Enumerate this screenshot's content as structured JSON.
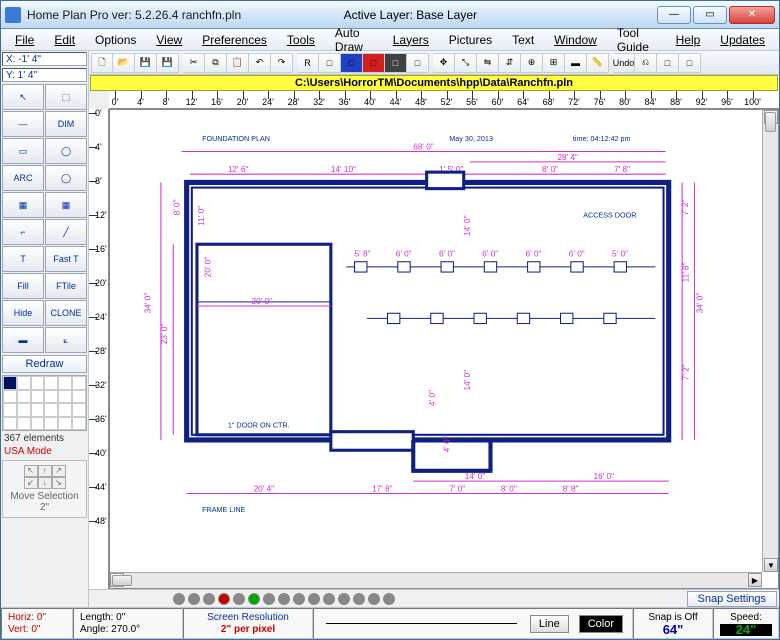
{
  "title": "Home Plan Pro ver: 5.2.26.4   ranchfn.pln",
  "active_layer_label": "Active Layer: Base Layer",
  "menu": [
    "File",
    "Edit",
    "Options",
    "View",
    "Preferences",
    "Tools",
    "Auto Draw",
    "Layers",
    "Pictures",
    "Text",
    "Window",
    "Tool Guide",
    "Help",
    "Updates"
  ],
  "coords": {
    "x": "X: -1' 4\"",
    "y": "Y: 1' 4\""
  },
  "left_tools": [
    "↖",
    "⬚",
    "—",
    "DIM",
    "▭",
    "◯",
    "ARC",
    "◯",
    "▦",
    "▦",
    "⌐",
    "╱",
    "T",
    "Fast T",
    "Fill",
    "FTile",
    "Hide",
    "CLONE",
    "▬",
    "⟀"
  ],
  "redraw": "Redraw",
  "elements": "367 elements",
  "mode": "USA Mode",
  "move_sel": "Move Selection 2\"",
  "path": "C:\\Users\\HorrorTM\\Documents\\hpp\\Data\\Ranchfn.pln",
  "ruler_h": [
    "0'",
    "4'",
    "8'",
    "12'",
    "16'",
    "20'",
    "24'",
    "28'",
    "32'",
    "36'",
    "40'",
    "44'",
    "48'",
    "52'",
    "56'",
    "60'",
    "64'",
    "68'",
    "72'",
    "76'",
    "80'",
    "84'",
    "88'",
    "92'",
    "96'",
    "100'"
  ],
  "ruler_v": [
    "0'",
    "4'",
    "8'",
    "12'",
    "16'",
    "20'",
    "24'",
    "28'",
    "32'",
    "36'",
    "40'",
    "44'",
    "48'"
  ],
  "plan": {
    "title_left": "FOUNDATION PLAN",
    "title_mid": "May 30, 2013",
    "title_right": "time: 04:12:42 pm",
    "frame_note": "FRAME LINE",
    "door_note": "1\" DOOR ON CTR.",
    "access": "ACCESS DOOR",
    "dims_top": [
      "68' 0\"",
      "28' 4\"",
      "12' 6\"",
      "14' 10\"",
      "1' 5' 0\"",
      "8' 0\"",
      "7' 8\""
    ],
    "dims_left": [
      "34' 0\"",
      "23' 0\"",
      "8' 0\"",
      "11' 0\"",
      "20' 0\""
    ],
    "dims_right": [
      "34' 0\"",
      "11' 8\"",
      "7' 2\"",
      "7' 2\""
    ],
    "dims_bottom": [
      "20' 4\"",
      "17' 8\"",
      "7' 0\"",
      "8' 0\"",
      "8' 8\"",
      "14' 0\"",
      "16' 0\""
    ],
    "dims_inner": [
      "5' 8\"",
      "6' 0\"",
      "6' 0\"",
      "6' 0\"",
      "6' 0\"",
      "6' 0\"",
      "5' 0\"",
      "14' 0\"",
      "14' 0\"",
      "4' 0\"",
      "4' 6\"",
      "20' 0\""
    ]
  },
  "toolbar_top": [
    "new",
    "open",
    "save",
    "save2",
    "cut",
    "copy",
    "paste",
    "undo",
    "redo",
    "reg",
    "tool-a",
    "tool-b",
    "red",
    "sel",
    "blank",
    "move",
    "resize",
    "flip-h",
    "flip-v",
    "center",
    "snap-a",
    "strike",
    "ruler",
    "und1",
    "und2",
    "extra1",
    "extra2"
  ],
  "status_dots": 15,
  "snap_settings": "Snap Settings",
  "bottom": {
    "horiz": "Horiz: 0\"",
    "vert": "Vert:  0\"",
    "length": "Length:  0\"",
    "angle": "Angle:  270.0°",
    "res_label": "Screen Resolution",
    "res_val": "2\" per pixel",
    "line_btn": "Line",
    "color_btn": "Color",
    "snap_lbl": "Snap is Off",
    "snap_val": "64\"",
    "speed_lbl": "Speed:",
    "speed_val": "24\""
  }
}
